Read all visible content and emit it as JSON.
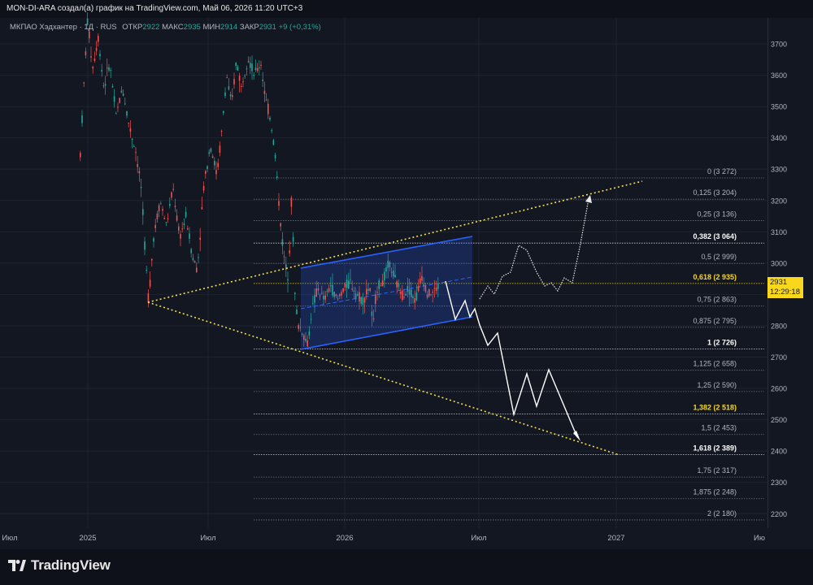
{
  "header": {
    "title": "MON-DI-ARA создал(а) график на TradingView.com, Май 06, 2026 11:20 UTC+3"
  },
  "legend": {
    "symbol": "МКПАО Хэдхантер · 1Д · RUS",
    "open_label": "ОТКР",
    "open_value": "2922",
    "high_label": "МАКС",
    "high_value": "2935",
    "low_label": "МИН",
    "low_value": "2914",
    "close_label": "ЗАКР",
    "close_value": "2931",
    "change": "+9 (+0,31%)"
  },
  "price_axis": {
    "ticks": [
      "3700",
      "3600",
      "3500",
      "3400",
      "3300",
      "3200",
      "3100",
      "3000",
      "2900",
      "2800",
      "2700",
      "2600",
      "2500",
      "2400",
      "2300",
      "2200"
    ]
  },
  "time_axis": {
    "labels": [
      "Июл",
      "2025",
      "Июл",
      "2026",
      "Июл",
      "2027",
      "Ию"
    ]
  },
  "fib_levels": [
    {
      "ratio": "0",
      "price": "3 272",
      "value": 3272
    },
    {
      "ratio": "0,125",
      "price": "3 204",
      "value": 3204
    },
    {
      "ratio": "0,25",
      "price": "3 136",
      "value": 3136
    },
    {
      "ratio": "0,382",
      "price": "3 064",
      "value": 3064
    },
    {
      "ratio": "0,5",
      "price": "2 999",
      "value": 2999
    },
    {
      "ratio": "0,618",
      "price": "2 935",
      "value": 2935
    },
    {
      "ratio": "0,75",
      "price": "2 863",
      "value": 2863
    },
    {
      "ratio": "0,875",
      "price": "2 795",
      "value": 2795
    },
    {
      "ratio": "1",
      "price": "2 726",
      "value": 2726
    },
    {
      "ratio": "1,125",
      "price": "2 658",
      "value": 2658
    },
    {
      "ratio": "1,25",
      "price": "2 590",
      "value": 2590
    },
    {
      "ratio": "1,382",
      "price": "2 518",
      "value": 2518
    },
    {
      "ratio": "1,5",
      "price": "2 453",
      "value": 2453
    },
    {
      "ratio": "1,618",
      "price": "2 389",
      "value": 2389
    },
    {
      "ratio": "1,75",
      "price": "2 317",
      "value": 2317
    },
    {
      "ratio": "1,875",
      "price": "2 248",
      "value": 2248
    },
    {
      "ratio": "2",
      "price": "2 180",
      "value": 2180
    }
  ],
  "last_price": {
    "price": "2931",
    "countdown": "12:29:18"
  },
  "colors": {
    "background": "#131722",
    "bull": "#26a69a",
    "bear": "#ef5350",
    "fib_highlight": "#f9d71c",
    "channel": "#2962ff",
    "triangle": "#f4e04d"
  },
  "footer": {
    "brand": "TradingView"
  }
}
